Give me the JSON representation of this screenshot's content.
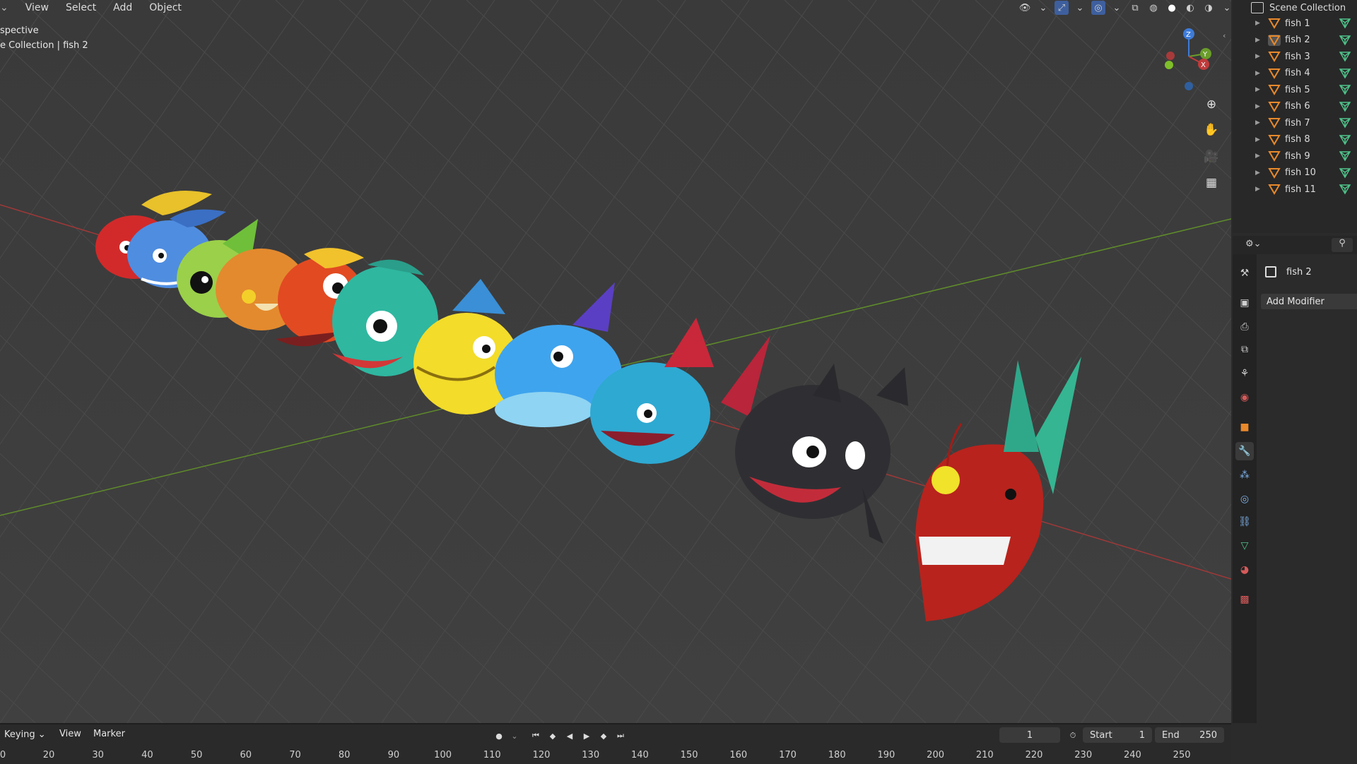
{
  "menu": {
    "view": "View",
    "select": "Select",
    "add": "Add",
    "object": "Object"
  },
  "viewport": {
    "mode_label": "spective",
    "collection_label": "e Collection | fish 2"
  },
  "outliner": {
    "root": "Scene Collection",
    "items": [
      "fish 1",
      "fish 2",
      "fish 3",
      "fish 4",
      "fish 5",
      "fish 6",
      "fish 7",
      "fish 8",
      "fish 9",
      "fish 10",
      "fish 11"
    ],
    "selected": "fish 2"
  },
  "properties": {
    "object_name": "fish 2",
    "add_modifier": "Add Modifier"
  },
  "timeline": {
    "keying": "Keying",
    "view": "View",
    "marker": "Marker",
    "current_frame": "1",
    "start_label": "Start",
    "start_value": "1",
    "end_label": "End",
    "end_value": "250",
    "ruler": [
      "0",
      "20",
      "30",
      "40",
      "50",
      "60",
      "70",
      "80",
      "90",
      "100",
      "110",
      "120",
      "130",
      "140",
      "150",
      "160",
      "170",
      "180",
      "190",
      "200",
      "210",
      "220",
      "230",
      "240",
      "250"
    ]
  },
  "colors": {
    "accent": "#e8892b",
    "mesh_green": "#4fc28a",
    "axis_x": "#c03b3b",
    "axis_y": "#6a9d2a",
    "axis_z": "#3d7bd9"
  }
}
